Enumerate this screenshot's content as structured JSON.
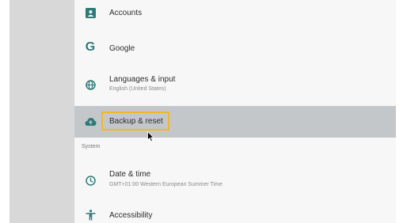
{
  "settings": {
    "items": [
      {
        "title": "Accounts",
        "subtitle": "",
        "icon": "account-box-icon"
      },
      {
        "title": "Google",
        "subtitle": "",
        "icon": "google-g-icon"
      },
      {
        "title": "Languages & input",
        "subtitle": "English (United States)",
        "icon": "globe-icon"
      },
      {
        "title": "Backup & reset",
        "subtitle": "",
        "icon": "cloud-upload-icon"
      },
      {
        "title": "Date & time",
        "subtitle": "GMT+01:00 Western European Summer Time",
        "icon": "clock-icon"
      },
      {
        "title": "Accessibility",
        "subtitle": "",
        "icon": "accessibility-icon"
      }
    ],
    "section_system": "System",
    "selected_index": 3
  },
  "colors": {
    "accent": "#2f7a78",
    "focus": "#f2b728",
    "selected_bg": "#c3c7ca"
  }
}
